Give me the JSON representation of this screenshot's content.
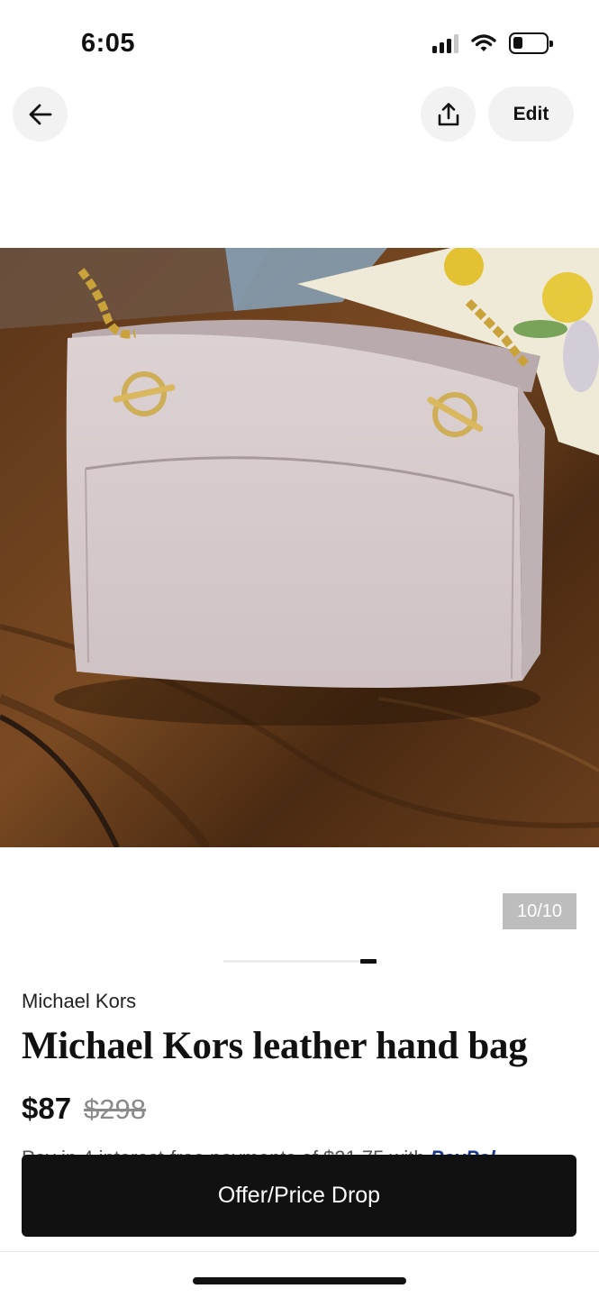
{
  "status_bar": {
    "time": "6:05",
    "icons": [
      "cellular-signal-icon",
      "wifi-icon",
      "battery-icon"
    ]
  },
  "nav": {
    "back_icon": "arrow-left-icon",
    "share_icon": "share-upload-icon",
    "edit_label": "Edit"
  },
  "photo": {
    "subject": "listing-photo",
    "counter": "10/10",
    "carousel_position": 1.0
  },
  "listing": {
    "brand": "Michael Kors",
    "title": "Michael Kors leather hand bag",
    "price": "$87",
    "original_price": "$298",
    "installment_text": "Pay in 4 interest-free payments of $21.75 with",
    "installment_provider": "PayPal"
  },
  "action": {
    "offer_label": "Offer/Price Drop"
  },
  "colors": {
    "primary_button": "#111111",
    "nav_button_bg": "#f2f2f2",
    "counter_bg": "#bdbdbd",
    "strike_price": "#8a8a8a"
  }
}
